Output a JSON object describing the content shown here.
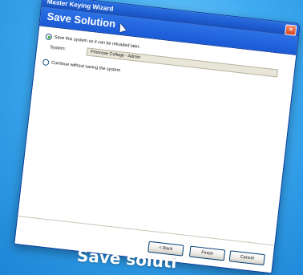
{
  "window": {
    "title": "Master Keying Wizard",
    "close_glyph": "×",
    "header_title": "Save Solution"
  },
  "options": {
    "save_label": "Save this system so it can be reloaded later.",
    "system_label": "System:",
    "system_value": "Primrose College - Admin",
    "continue_label": "Continue without saving the system"
  },
  "buttons": {
    "back": "< Back",
    "finish": "Finish",
    "cancel": "Cancel"
  },
  "caption": "Save soluti"
}
